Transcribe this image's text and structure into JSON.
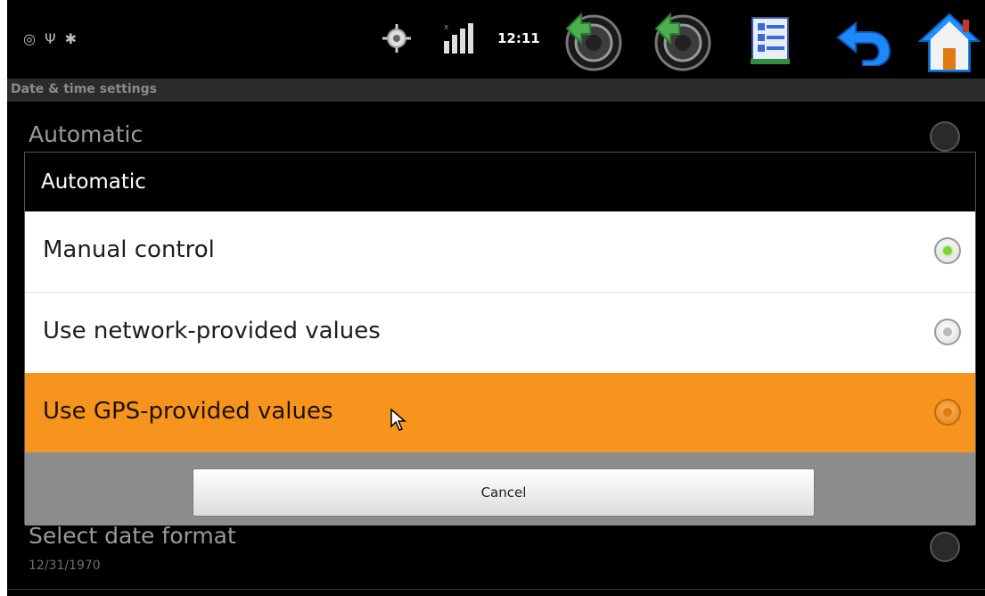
{
  "status_bar": {
    "clock": "12:11",
    "icons": [
      "settings-small-icon",
      "usb-icon",
      "debug-icon",
      "gps-icon",
      "signal-icon",
      "volume-down-icon",
      "volume-up-icon",
      "menu-icon",
      "back-icon",
      "home-icon"
    ]
  },
  "settings": {
    "title": "Date & time settings",
    "automatic_label": "Automatic",
    "date_format_label": "Select date format",
    "date_format_value": "12/31/1970"
  },
  "dialog": {
    "title": "Automatic",
    "options": [
      {
        "label": "Manual control",
        "selected": true
      },
      {
        "label": "Use network-provided values",
        "selected": false
      },
      {
        "label": "Use GPS-provided values",
        "selected": false
      }
    ],
    "cancel_label": "Cancel"
  },
  "colors": {
    "highlight": "#f7941d",
    "selected_dot": "#7fd43a",
    "home_accent": "#1e90ff"
  }
}
